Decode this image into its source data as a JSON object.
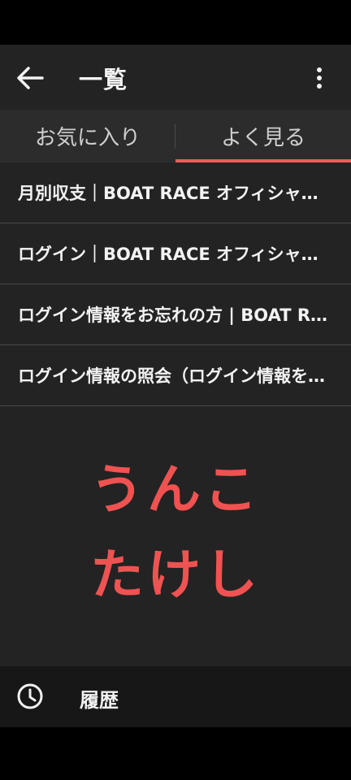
{
  "toolbar": {
    "title": "一覧",
    "back_icon": "arrow-left-icon",
    "more_icon": "more-vertical-icon"
  },
  "tabs": [
    {
      "label": "お気に入り",
      "selected": false
    },
    {
      "label": "よく見る",
      "selected": true
    }
  ],
  "list": {
    "items": [
      {
        "label": "月別収支｜BOAT RACE オフィシャルウェブサイト"
      },
      {
        "label": "ログイン｜BOAT RACE オフィシャルウェブサイト"
      },
      {
        "label": "ログイン情報をお忘れの方 | BOAT RACE オフィシャルウェブサイト"
      },
      {
        "label": "ログイン情報の照会（ログイン情報をお忘れの方）"
      }
    ]
  },
  "overlay_text": {
    "line1": "うんこ",
    "line2": "たけし"
  },
  "bottom_bar": {
    "label": "履歴",
    "icon": "clock-icon"
  },
  "colors": {
    "accent": "#ef5b5b",
    "overlay_text": "#f05252",
    "background": "#232323"
  }
}
